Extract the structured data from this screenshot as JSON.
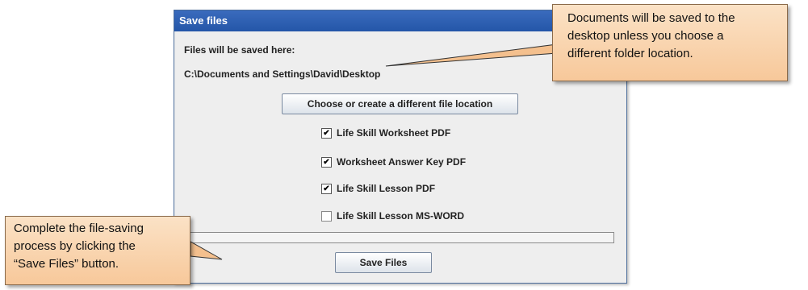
{
  "dialog": {
    "title": "Save files",
    "saved_here_label": "Files will be saved here:",
    "path": "C:\\Documents and Settings\\David\\Desktop",
    "choose_button": "Choose or create a different file location",
    "save_button": "Save Files",
    "options": [
      {
        "label": "Life Skill Worksheet PDF",
        "checked": true
      },
      {
        "label": "Worksheet Answer Key PDF",
        "checked": true
      },
      {
        "label": "Life Skill Lesson PDF",
        "checked": true
      },
      {
        "label": "Life Skill Lesson MS-WORD",
        "checked": false
      }
    ]
  },
  "callouts": {
    "top": [
      "Documents will be saved to the",
      "desktop unless you choose a",
      "different folder location."
    ],
    "bottom": [
      "Complete the file-saving",
      "process by clicking the",
      "“Save Files” button."
    ]
  },
  "colors": {
    "titlebar": "#2f62b5",
    "callout_fill": "#f9d4ad",
    "window_bg": "#eeeeee"
  }
}
